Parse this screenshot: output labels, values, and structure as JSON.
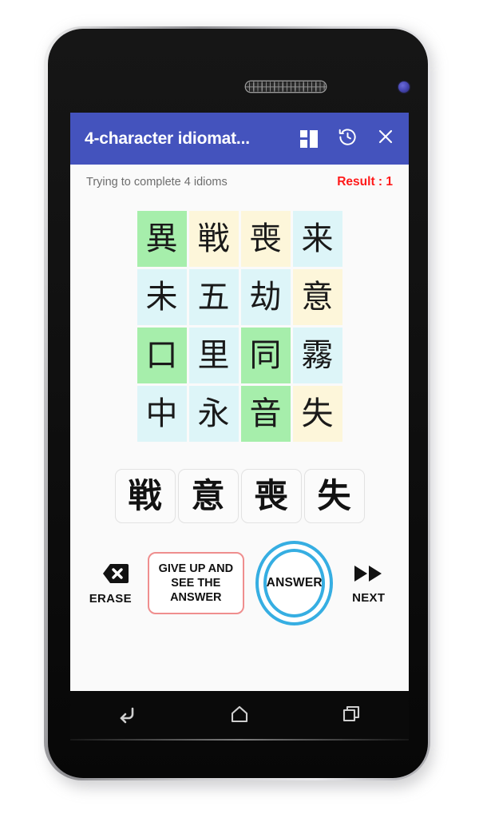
{
  "appbar": {
    "title": "4-character idiomat...",
    "icons": {
      "dashboard": "dashboard-icon",
      "history": "history-icon",
      "close": "close-icon"
    },
    "close_glyph": "✕",
    "color": "#4453bd"
  },
  "status": {
    "left": "Trying to complete 4 idioms",
    "right": "Result : 1",
    "result_color": "#ff1a1a"
  },
  "grid": {
    "rows": 4,
    "cols": 4,
    "colors": {
      "green": "#a6eeab",
      "cream": "#fdf6da",
      "cyan": "#ddf5f8"
    },
    "cells": [
      {
        "char": "異",
        "color": "green"
      },
      {
        "char": "戦",
        "color": "cream"
      },
      {
        "char": "喪",
        "color": "cream"
      },
      {
        "char": "来",
        "color": "cyan"
      },
      {
        "char": "未",
        "color": "cyan"
      },
      {
        "char": "五",
        "color": "cyan"
      },
      {
        "char": "劫",
        "color": "cyan"
      },
      {
        "char": "意",
        "color": "cream"
      },
      {
        "char": "口",
        "color": "green"
      },
      {
        "char": "里",
        "color": "cyan"
      },
      {
        "char": "同",
        "color": "green"
      },
      {
        "char": "霧",
        "color": "cyan"
      },
      {
        "char": "中",
        "color": "cyan"
      },
      {
        "char": "永",
        "color": "cyan"
      },
      {
        "char": "音",
        "color": "green"
      },
      {
        "char": "失",
        "color": "cream"
      }
    ]
  },
  "answer_slots": [
    {
      "char": "戦"
    },
    {
      "char": "意"
    },
    {
      "char": "喪"
    },
    {
      "char": "失"
    }
  ],
  "controls": {
    "erase": {
      "label": "ERASE",
      "icon": "backspace-icon"
    },
    "give_up": {
      "label": "GIVE UP AND SEE THE ANSWER",
      "border_color": "#ef8e8e"
    },
    "answer": {
      "label": "ANSWER",
      "ring_color": "#36aee2"
    },
    "next": {
      "label": "NEXT",
      "icon": "fast-forward-icon"
    }
  },
  "navbar": {
    "back": "back-icon",
    "home": "home-icon",
    "recents": "recents-icon"
  }
}
